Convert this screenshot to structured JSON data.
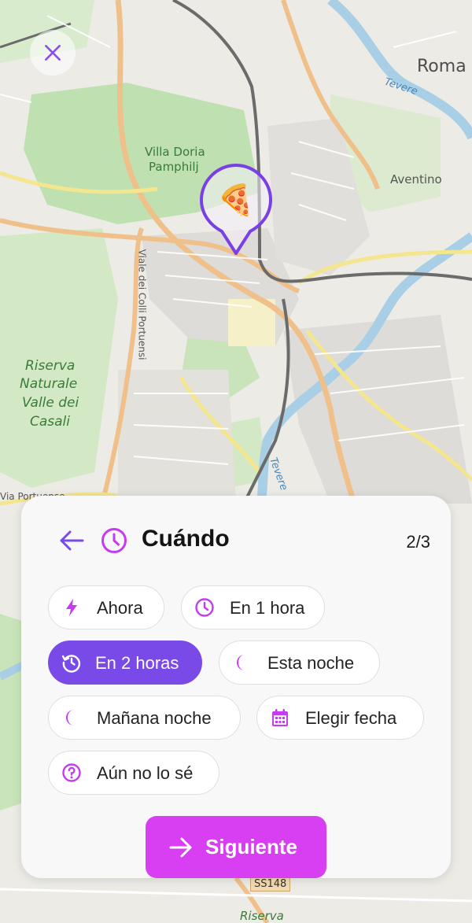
{
  "map": {
    "labels": {
      "roma": "Roma",
      "tevere_north": "Tevere",
      "villa_doria_1": "Villa Doria",
      "villa_doria_2": "Pamphilj",
      "aventino": "Aventino",
      "viale_coll": "Viale dei Colli Portuensi",
      "riserva_1": "Riserva",
      "riserva_2": "Naturale",
      "riserva_3": "Valle dei",
      "riserva_4": "Casali",
      "tevere_south": "Tevere",
      "via_portuense": "Via Portuense",
      "ss148": "SS148",
      "riserva_bottom": "Riserva"
    },
    "marker_emoji": "🍕"
  },
  "close_icon": "close-icon",
  "panel": {
    "title": "Cuándo",
    "step": "2/3",
    "back_icon": "arrow-left-icon",
    "title_icon": "clock-icon",
    "options": [
      {
        "label": "Ahora",
        "icon": "bolt-icon",
        "selected": false
      },
      {
        "label": "En 1 hora",
        "icon": "clock-icon",
        "selected": false
      },
      {
        "label": "En 2 horas",
        "icon": "clock-rotate-icon",
        "selected": true
      },
      {
        "label": "Esta noche",
        "icon": "moon-icon",
        "selected": false
      },
      {
        "label": "Mañana noche",
        "icon": "moon-icon",
        "selected": false
      },
      {
        "label": "Elegir fecha",
        "icon": "calendar-icon",
        "selected": false
      },
      {
        "label": "Aún no lo sé",
        "icon": "question-icon",
        "selected": false
      }
    ],
    "next_label": "Siguiente"
  },
  "colors": {
    "accent_purple": "#7a4ae9",
    "accent_magenta": "#d83ef2",
    "icon_magenta": "#c63bef"
  }
}
